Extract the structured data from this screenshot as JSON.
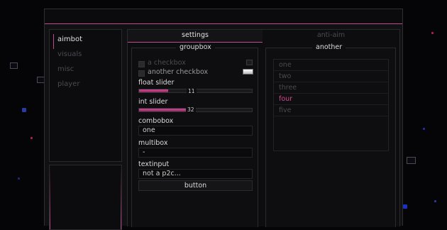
{
  "colors": {
    "accent": "#c04a8a",
    "window_bg": "#111114",
    "inactive_text": "#4a4a52"
  },
  "sidebar": {
    "items": [
      {
        "label": "aimbot",
        "active": true
      },
      {
        "label": "visuals",
        "active": false
      },
      {
        "label": "misc",
        "active": false
      },
      {
        "label": "player",
        "active": false
      }
    ]
  },
  "tabs": [
    {
      "label": "settings",
      "active": true
    },
    {
      "label": "anti-aim",
      "active": false
    }
  ],
  "groupbox": {
    "title": "groupbox",
    "checkbox1": {
      "label": "a checkbox",
      "checked": false
    },
    "checkbox2": {
      "label": "another checkbox",
      "checked": false
    },
    "float_slider": {
      "label": "float slider",
      "value": "11",
      "fraction": 0.26
    },
    "int_slider": {
      "label": "int slider",
      "value": "32",
      "fraction": 0.47
    },
    "combobox": {
      "label": "combobox",
      "value": "one"
    },
    "multibox": {
      "label": "multibox",
      "value": "-"
    },
    "textinput": {
      "label": "textinput",
      "value": "not a p2c..."
    },
    "button": {
      "label": "button"
    }
  },
  "another": {
    "title": "another",
    "items": [
      {
        "label": "one",
        "selected": false
      },
      {
        "label": "two",
        "selected": false
      },
      {
        "label": "three",
        "selected": false
      },
      {
        "label": "four",
        "selected": true
      },
      {
        "label": "five",
        "selected": false
      }
    ]
  }
}
